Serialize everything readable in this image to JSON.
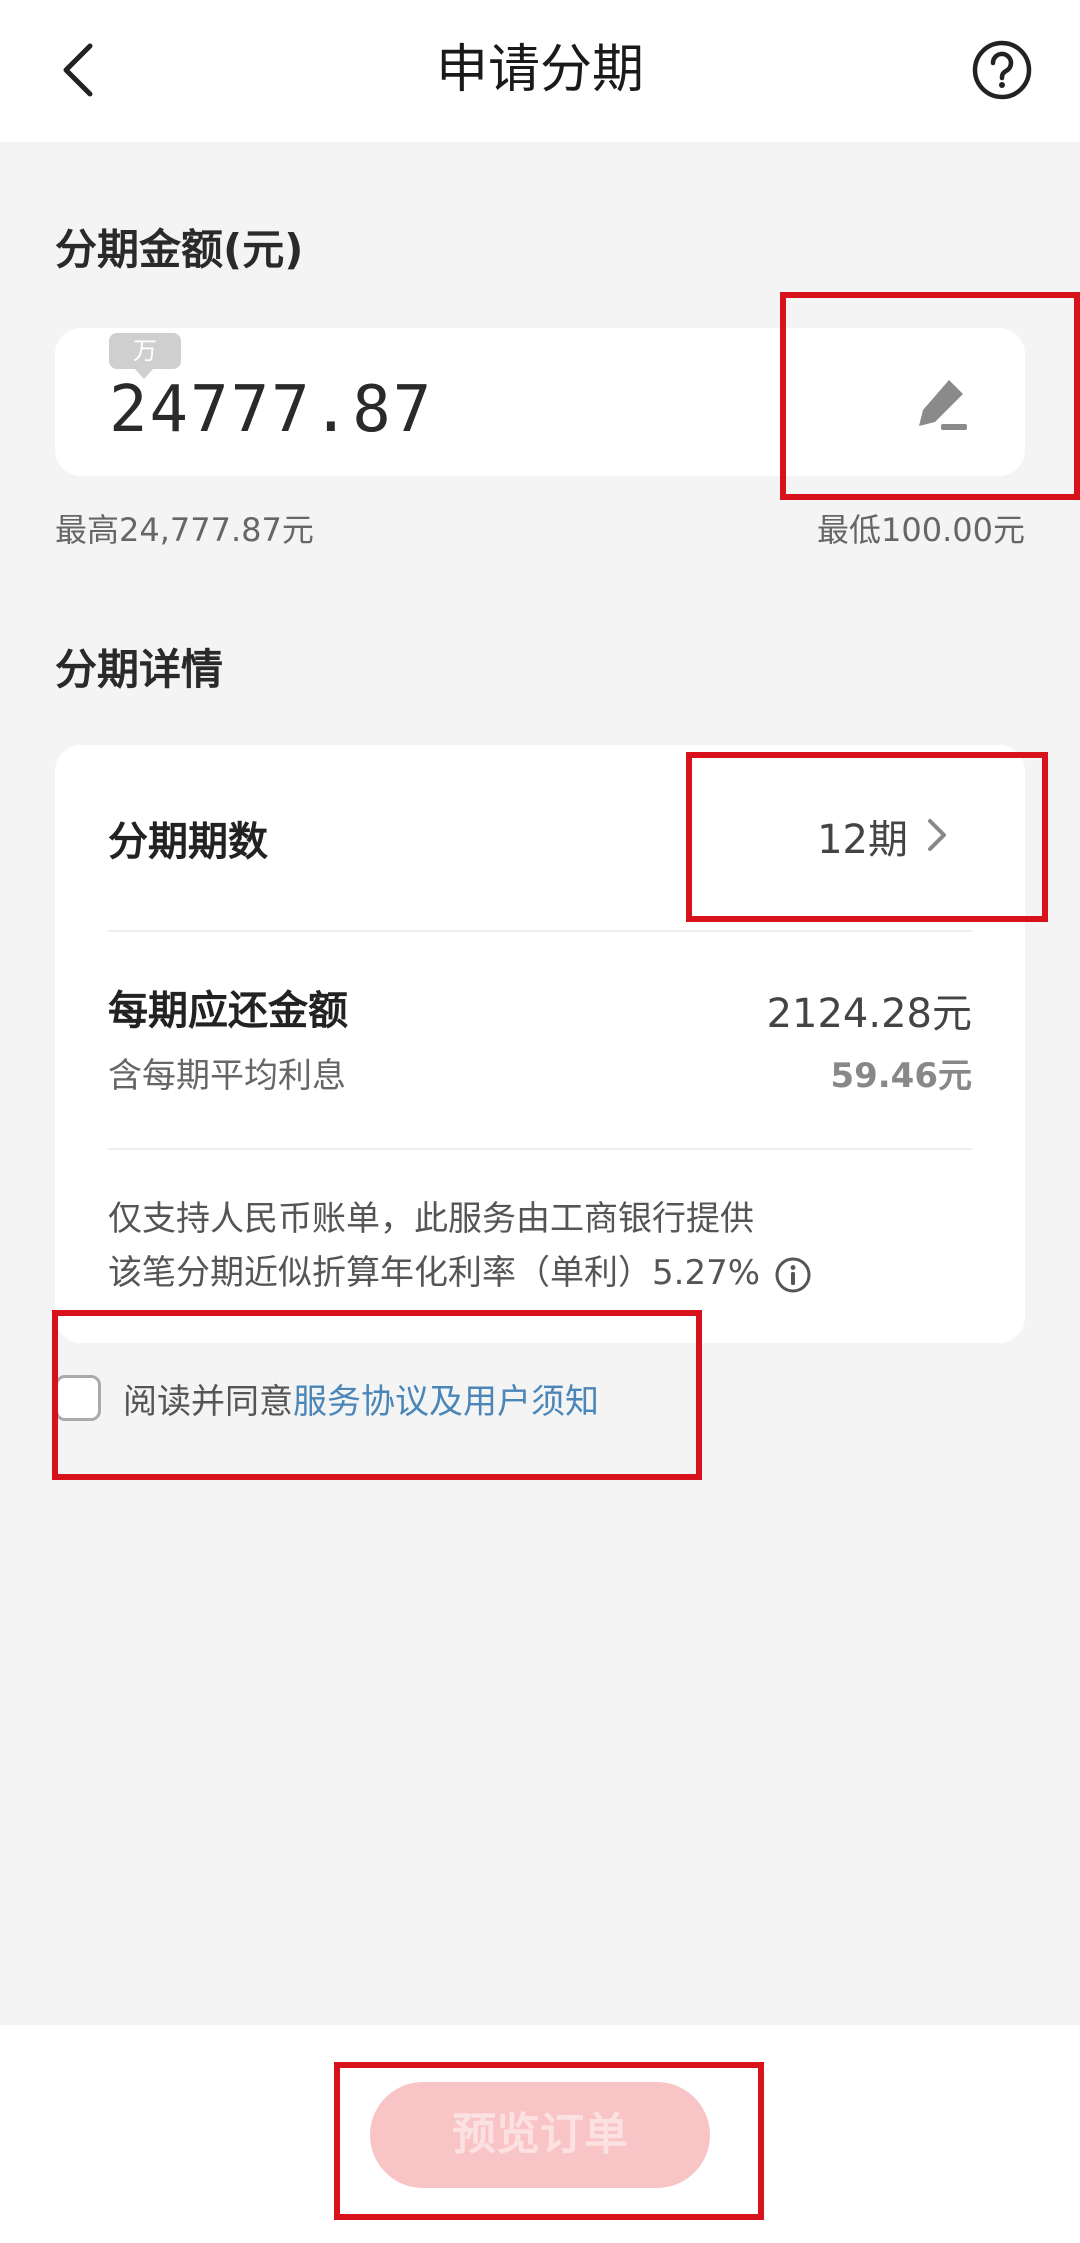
{
  "header": {
    "title": "申请分期",
    "back_icon": "chevron-left-icon",
    "help_icon": "question-circle-icon"
  },
  "amount_section": {
    "title": "分期金额(元)",
    "unit_badge": "万",
    "amount_value": "24777.87",
    "edit_icon": "pencil-icon",
    "max_text": "最高24,777.87元",
    "min_text": "最低100.00元"
  },
  "details_section": {
    "title": "分期详情",
    "term_label": "分期期数",
    "term_value": "12期",
    "per_period_label": "每期应还金额",
    "per_period_value": "2124.28元",
    "interest_label": "含每期平均利息",
    "interest_value": "59.46元",
    "note_line1": "仅支持人民币账单，此服务由工商银行提供",
    "note_line2": "该笔分期近似折算年化利率（单利）5.27%",
    "info_icon": "info-circle-icon"
  },
  "agreement": {
    "prefix": "阅读并同意",
    "link": "服务协议及用户须知",
    "checked": false
  },
  "footer": {
    "preview_button": "预览订单"
  },
  "colors": {
    "background": "#f4f4f4",
    "card": "#ffffff",
    "link": "#4a86b8",
    "button_disabled": "#f9c4c6",
    "annotation_red": "#d8121b"
  }
}
